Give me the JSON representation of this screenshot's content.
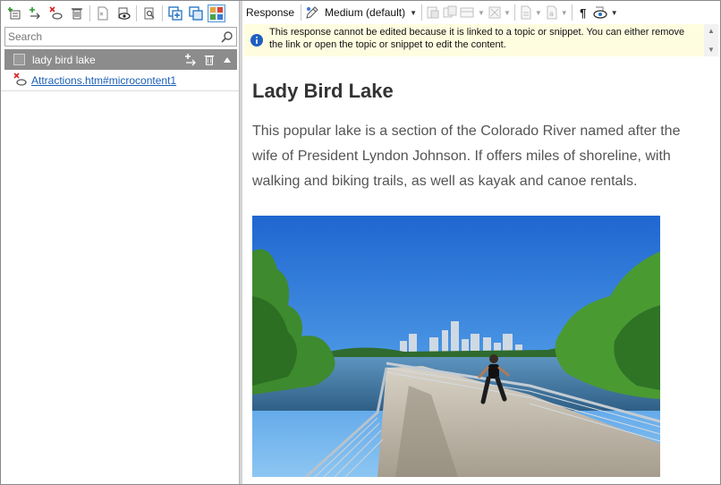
{
  "left_toolbar": {
    "buttons": [
      "add-topic-icon",
      "link-icon",
      "remove-link-icon",
      "delete-icon",
      "page-icon",
      "preview-icon",
      "find-icon",
      "add-snippet-icon",
      "copy-icon",
      "color-grid-icon"
    ]
  },
  "search": {
    "placeholder": "Search",
    "value": ""
  },
  "topic": {
    "label": "lady bird lake"
  },
  "link": {
    "text": "Attractions.htm#microcontent1"
  },
  "right_toolbar": {
    "label": "Response",
    "style_value": "Medium (default)"
  },
  "info": {
    "message": "This response cannot be edited because it is linked to a topic or snippet. You can either remove the link or open the topic or snippet to edit the content."
  },
  "content": {
    "heading": "Lady Bird Lake",
    "paragraph": "This popular lake is a section of the Colorado River named after the wife of President Lyndon Johnson. If offers miles of shoreline, with walking and biking trails, as well as kayak and canoe rentals."
  },
  "colors": {
    "accent": "#1a5fb4",
    "topic_row": "#8c8c8c",
    "info_bg": "#fffde0",
    "sky": "#2e7fd6"
  }
}
